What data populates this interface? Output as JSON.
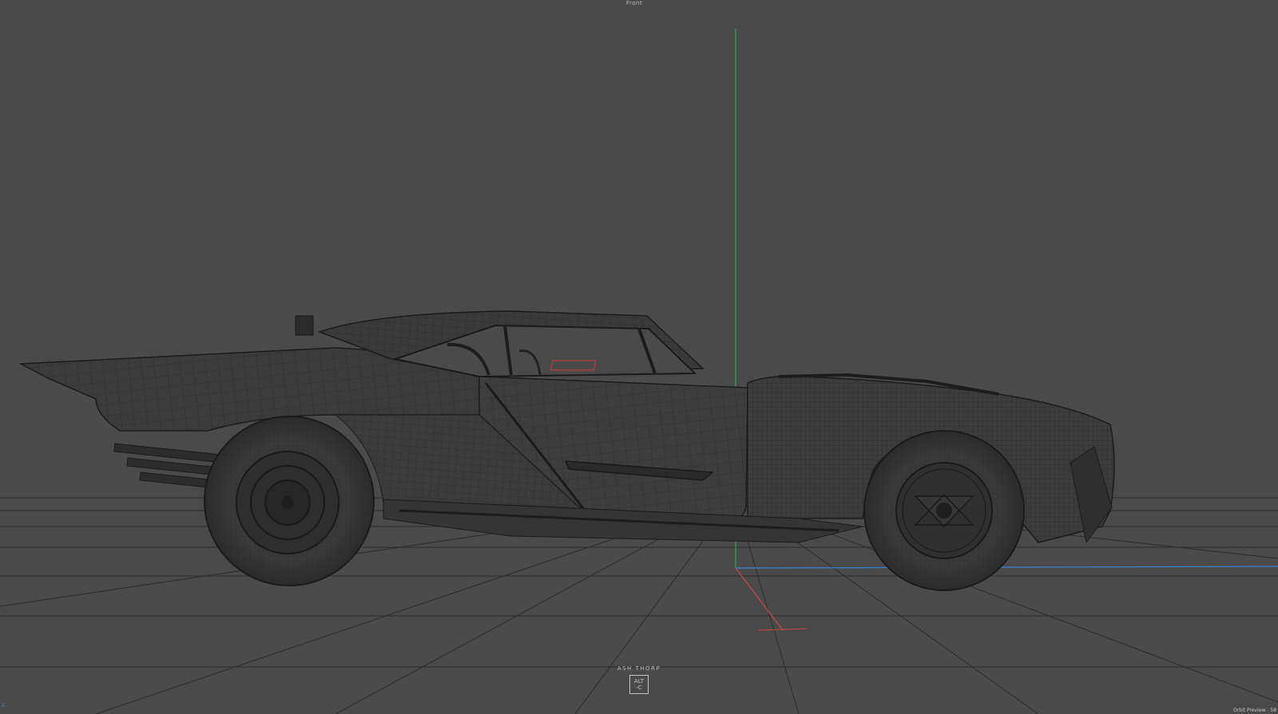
{
  "viewport": {
    "view_label": "Front",
    "watermark_name": "ASH THORP",
    "watermark_logo_line1": "ALT",
    "watermark_logo_line2": "-C",
    "bottom_left_label": "2",
    "bottom_right_label": "Orbit Preview - 58"
  },
  "colors": {
    "background": "#4a4a4a",
    "wire": "#1f1f1f",
    "grid": "#2c2c2c",
    "axis_y": "#3ea25a",
    "axis_x": "#c94545",
    "axis_z": "#3f7fc4",
    "selection": "#d03a3a"
  }
}
